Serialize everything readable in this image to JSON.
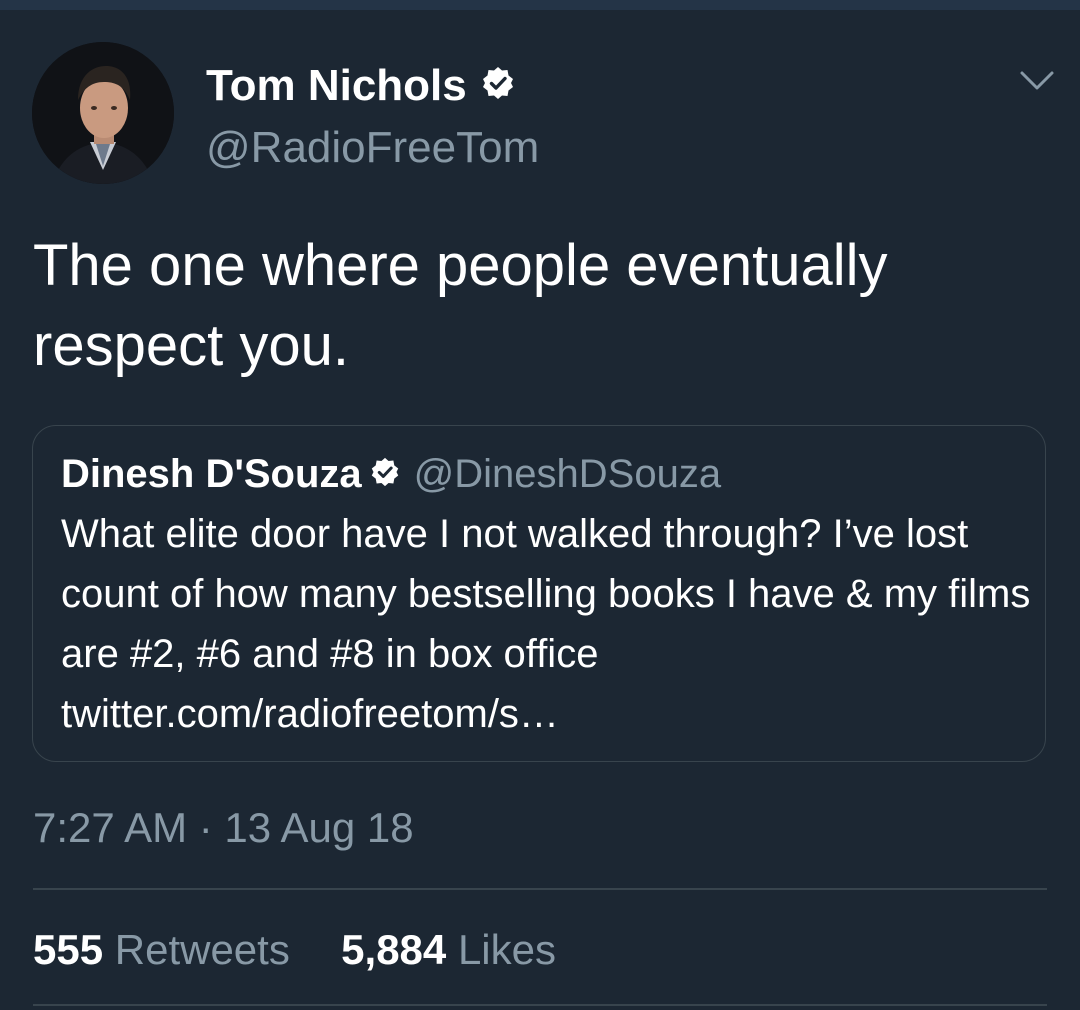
{
  "tweet": {
    "author": {
      "name": "Tom Nichols",
      "handle": "@RadioFreeTom",
      "verified": true
    },
    "text": "The one where people eventually respect you.",
    "quoted_tweet": {
      "author_name": "Dinesh D'Souza",
      "handle": "@DineshDSouza",
      "verified": true,
      "text": "What elite door have I not walked through? I’ve lost count of how many bestselling books I have & my films are #2, #6 and #8 in box office twitter.com/radiofreetom/s…"
    },
    "timestamp": "7:27 AM · 13 Aug 18",
    "stats": {
      "retweets_count": "555",
      "retweets_label": "Retweets",
      "likes_count": "5,884",
      "likes_label": "Likes"
    }
  },
  "icons": {
    "verified": "verified-badge-icon",
    "more": "chevron-down-icon"
  },
  "colors": {
    "background": "#1c2733",
    "secondary_text": "#8899a6",
    "border": "#38444d"
  }
}
